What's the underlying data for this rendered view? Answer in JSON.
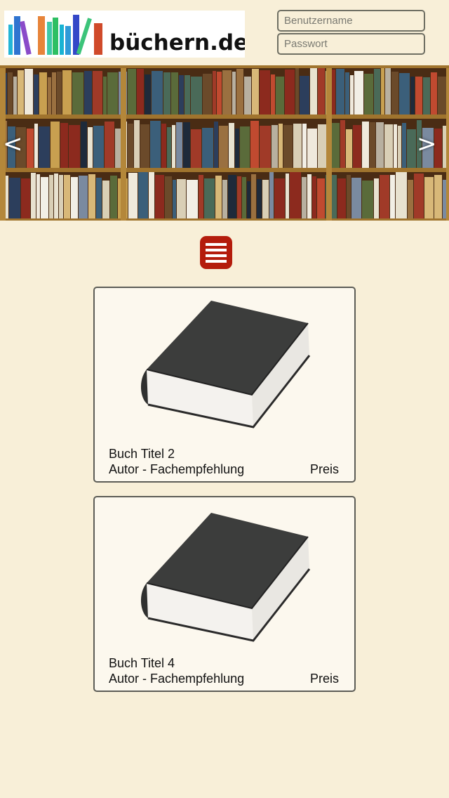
{
  "header": {
    "logo_text": "büchern.de",
    "username_placeholder": "Benutzername",
    "password_placeholder": "Passwort"
  },
  "slider": {
    "prev_label": "<",
    "next_label": ">"
  },
  "books": [
    {
      "title": "Buch Titel 2",
      "author": "Autor - Fachempfehlung",
      "price": "Preis"
    },
    {
      "title": "Buch Titel 4",
      "author": "Autor - Fachempfehlung",
      "price": "Preis"
    }
  ],
  "colors": {
    "background": "#f8efd8",
    "menu_button": "#b41c0c",
    "card_background": "#fcf8ee",
    "card_border": "#5c5c56"
  }
}
